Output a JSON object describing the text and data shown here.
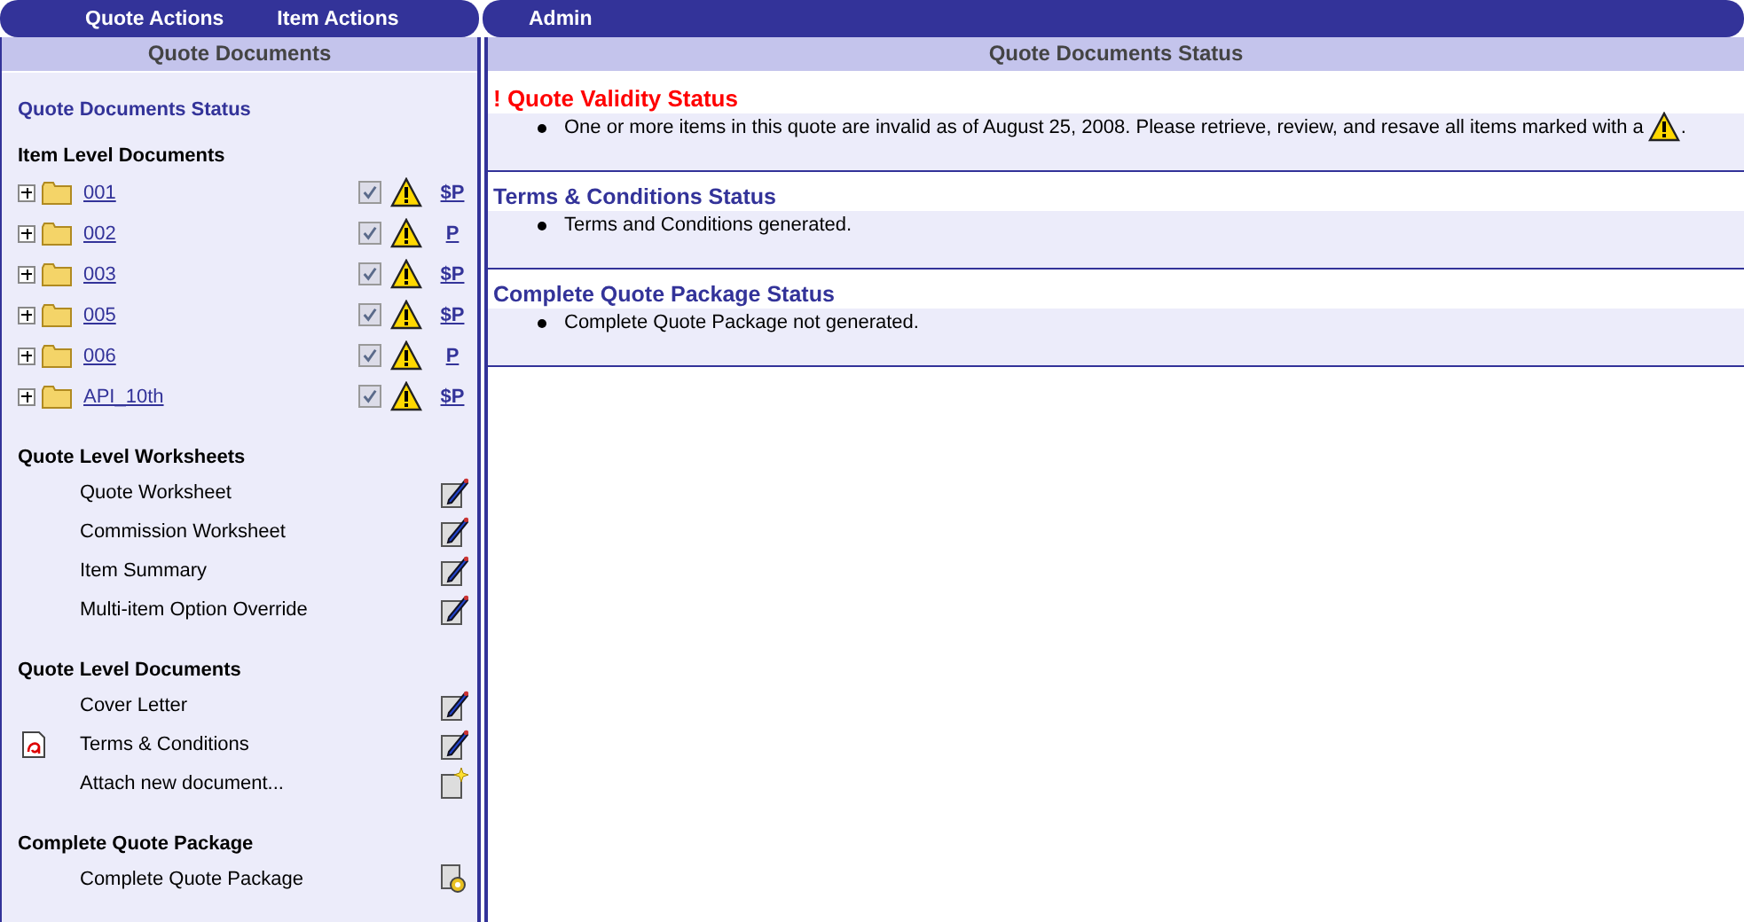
{
  "nav_left": [
    {
      "label": "Quote Actions"
    },
    {
      "label": "Item Actions"
    }
  ],
  "nav_right": [
    {
      "label": "Admin"
    }
  ],
  "sidebar": {
    "header": "Quote Documents",
    "status_link": "Quote Documents Status",
    "item_section": {
      "title": "Item Level Documents",
      "items": [
        {
          "label": "001",
          "checked": true,
          "pricing": "$P"
        },
        {
          "label": "002",
          "checked": true,
          "pricing": "P"
        },
        {
          "label": "003",
          "checked": true,
          "pricing": "$P"
        },
        {
          "label": "005",
          "checked": true,
          "pricing": "$P"
        },
        {
          "label": "006",
          "checked": true,
          "pricing": "P"
        },
        {
          "label": "API_10th",
          "checked": true,
          "pricing": "$P"
        }
      ]
    },
    "sections": [
      {
        "title": "Quote Level Worksheets",
        "items": [
          {
            "label": "Quote Worksheet",
            "kind": "edit"
          },
          {
            "label": "Commission Worksheet",
            "kind": "edit"
          },
          {
            "label": "Item Summary",
            "kind": "edit"
          },
          {
            "label": "Multi-item Option Override",
            "kind": "edit"
          }
        ]
      },
      {
        "title": "Quote Level Documents",
        "items": [
          {
            "label": "Cover Letter",
            "kind": "edit"
          },
          {
            "label": "Terms & Conditions",
            "kind": "edit",
            "pdf": true
          },
          {
            "label": "Attach new document...",
            "kind": "add"
          }
        ]
      },
      {
        "title": "Complete Quote Package",
        "items": [
          {
            "label": "Complete Quote Package",
            "kind": "generate"
          }
        ]
      }
    ]
  },
  "main": {
    "header": "Quote Documents Status",
    "sections": [
      {
        "kind": "error",
        "title": "! Quote Validity Status",
        "message": "One or more items in this quote are invalid as of August 25, 2008. Please retrieve, review, and resave all items marked with a",
        "message_end": ".",
        "warning_icon": true
      },
      {
        "kind": "info",
        "title": "Terms & Conditions Status",
        "message": "Terms and Conditions generated."
      },
      {
        "kind": "info",
        "title": "Complete Quote Package Status",
        "message": "Complete Quote Package not generated."
      }
    ]
  }
}
